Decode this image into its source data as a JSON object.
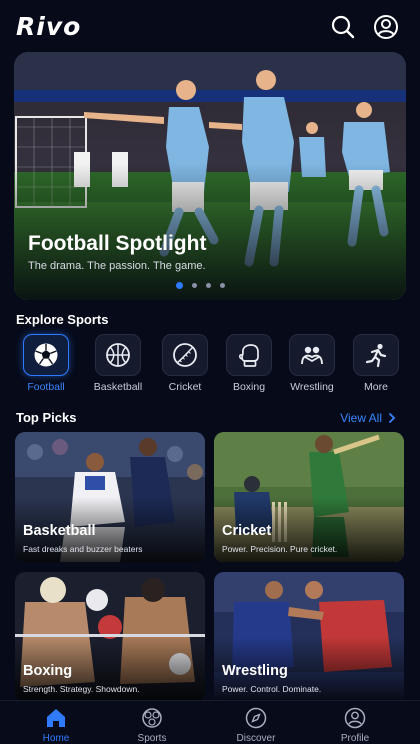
{
  "app": {
    "logo": "Rivo"
  },
  "header_icons": [
    "search-icon",
    "profile-icon"
  ],
  "hero": {
    "title": "Football Spotlight",
    "subtitle": "The drama. The passion. The game.",
    "slides": 4,
    "active_slide": 1
  },
  "explore": {
    "title": "Explore Sports",
    "items": [
      {
        "label": "Football",
        "icon": "football-icon",
        "selected": true
      },
      {
        "label": "Basketball",
        "icon": "basketball-icon",
        "selected": false
      },
      {
        "label": "Cricket",
        "icon": "cricket-ball-icon",
        "selected": false
      },
      {
        "label": "Boxing",
        "icon": "boxing-glove-icon",
        "selected": false
      },
      {
        "label": "Wrestling",
        "icon": "wrestling-icon",
        "selected": false
      },
      {
        "label": "More",
        "icon": "running-person-icon",
        "selected": false
      }
    ]
  },
  "top_picks": {
    "title": "Top Picks",
    "view_all": "View All",
    "cards": [
      {
        "title": "Basketball",
        "subtitle": "Fast dreaks and buzzer beaters"
      },
      {
        "title": "Cricket",
        "subtitle": "Power. Precision. Pure cricket."
      },
      {
        "title": "Boxing",
        "subtitle": "Strength. Strategy. Showdown."
      },
      {
        "title": "Wrestling",
        "subtitle": "Power. Control. Dominate."
      }
    ]
  },
  "nav": {
    "items": [
      {
        "label": "Home",
        "icon": "home-icon",
        "active": true
      },
      {
        "label": "Sports",
        "icon": "sports-icon",
        "active": false
      },
      {
        "label": "Discover",
        "icon": "compass-icon",
        "active": false
      },
      {
        "label": "Profile",
        "icon": "profile-icon",
        "active": false
      }
    ]
  },
  "colors": {
    "background": "#060a19",
    "accent": "#2f7bff",
    "text": "#ffffff",
    "muted": "#c9cdd9"
  }
}
